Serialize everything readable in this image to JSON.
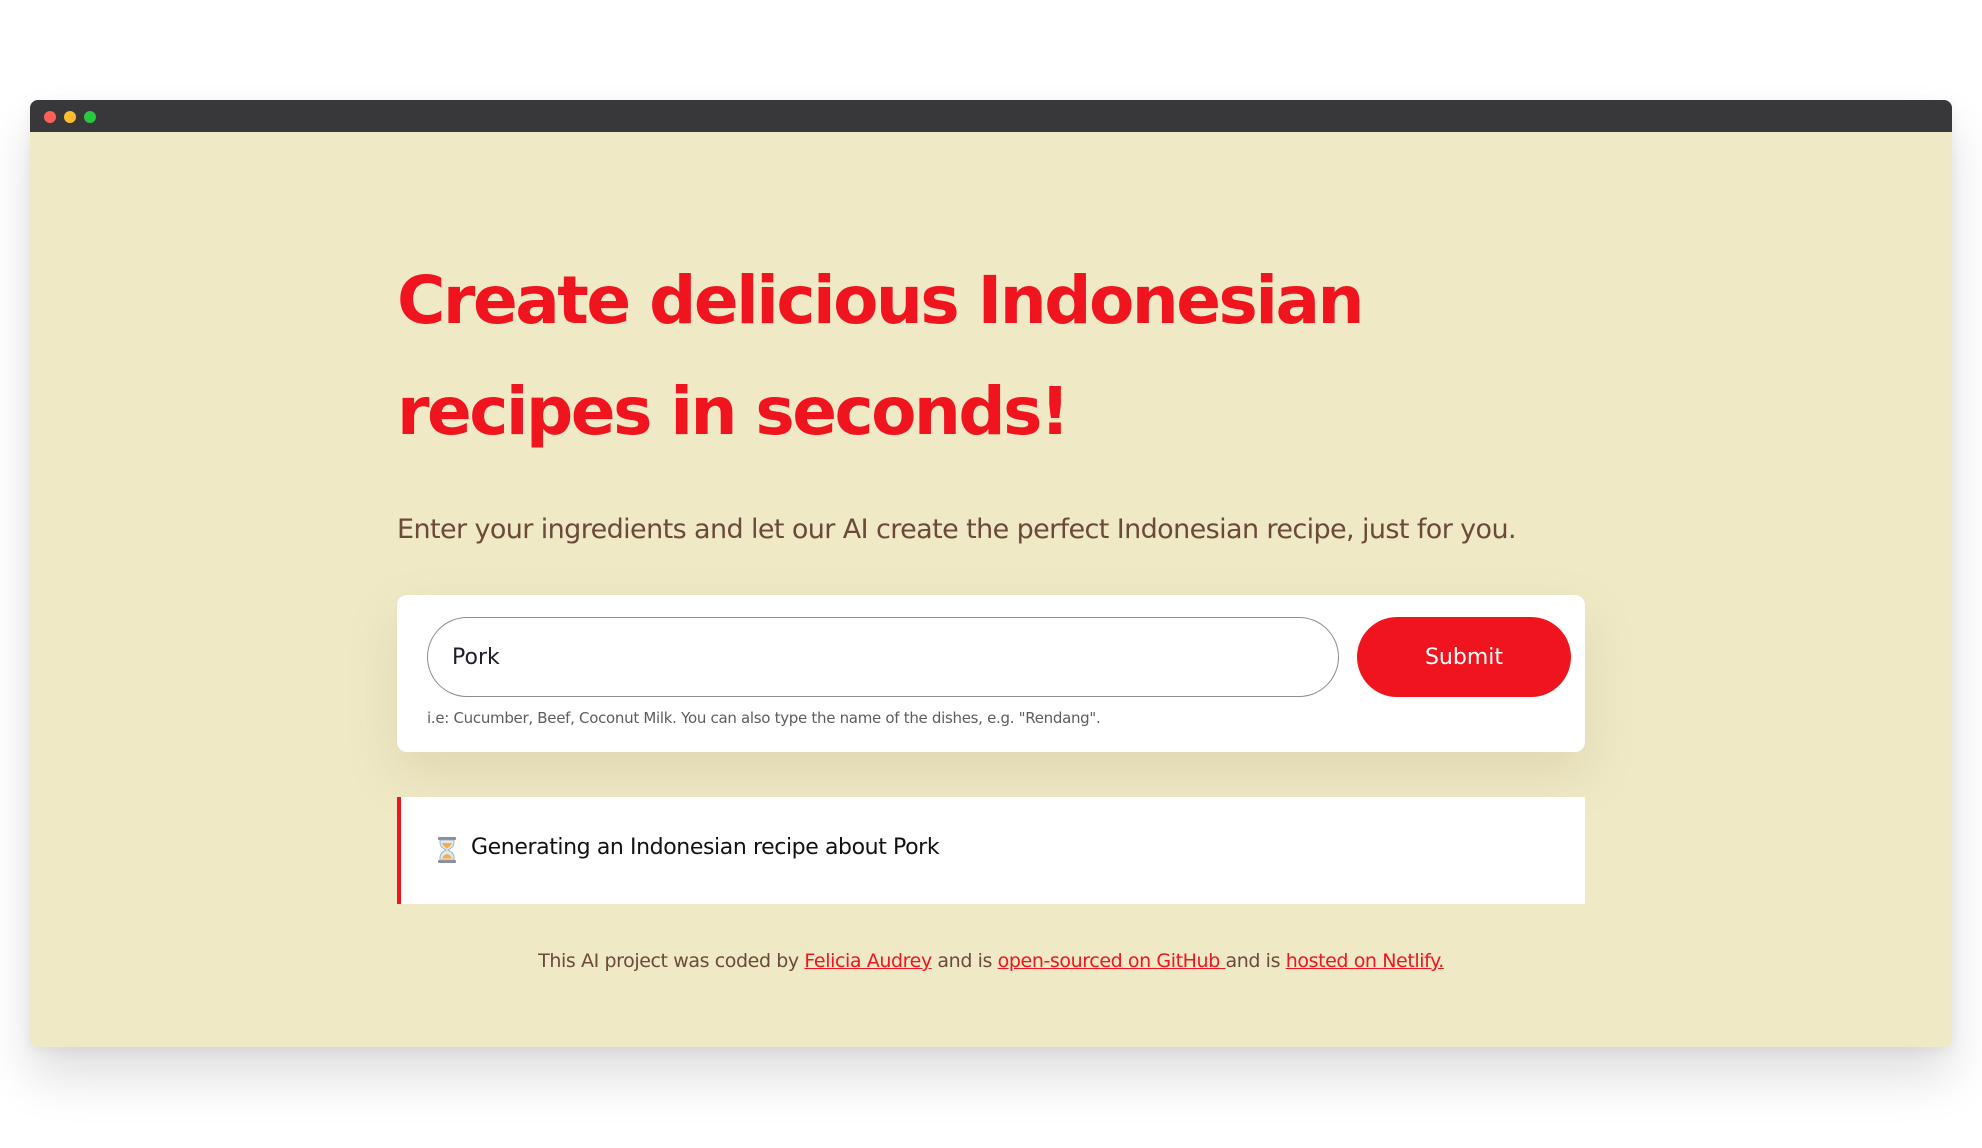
{
  "window": {
    "controls": [
      "close",
      "minimize",
      "zoom"
    ]
  },
  "hero": {
    "headline": "Create delicious Indonesian recipes in seconds!",
    "subtitle": "Enter your ingredients and let our AI create the perfect Indonesian recipe, just for you."
  },
  "form": {
    "input_value": "Pork",
    "submit_label": "Submit",
    "hint": "i.e: Cucumber, Beef, Coconut Milk. You can also type the name of the dishes, e.g. \"Rendang\"."
  },
  "status": {
    "icon": "hourglass-icon",
    "text": "Generating an Indonesian recipe about Pork"
  },
  "footer": {
    "prefix": "This AI project was coded by ",
    "author_link": "Felicia Audrey",
    "mid1": " and is ",
    "github_link": "open-sourced on GitHub ",
    "mid2": "and is ",
    "netlify_link": "hosted on Netlify."
  },
  "colors": {
    "accent": "#f0141e",
    "background": "#efe9c5",
    "text_brown": "#6b4a3a",
    "titlebar": "#38383a"
  }
}
